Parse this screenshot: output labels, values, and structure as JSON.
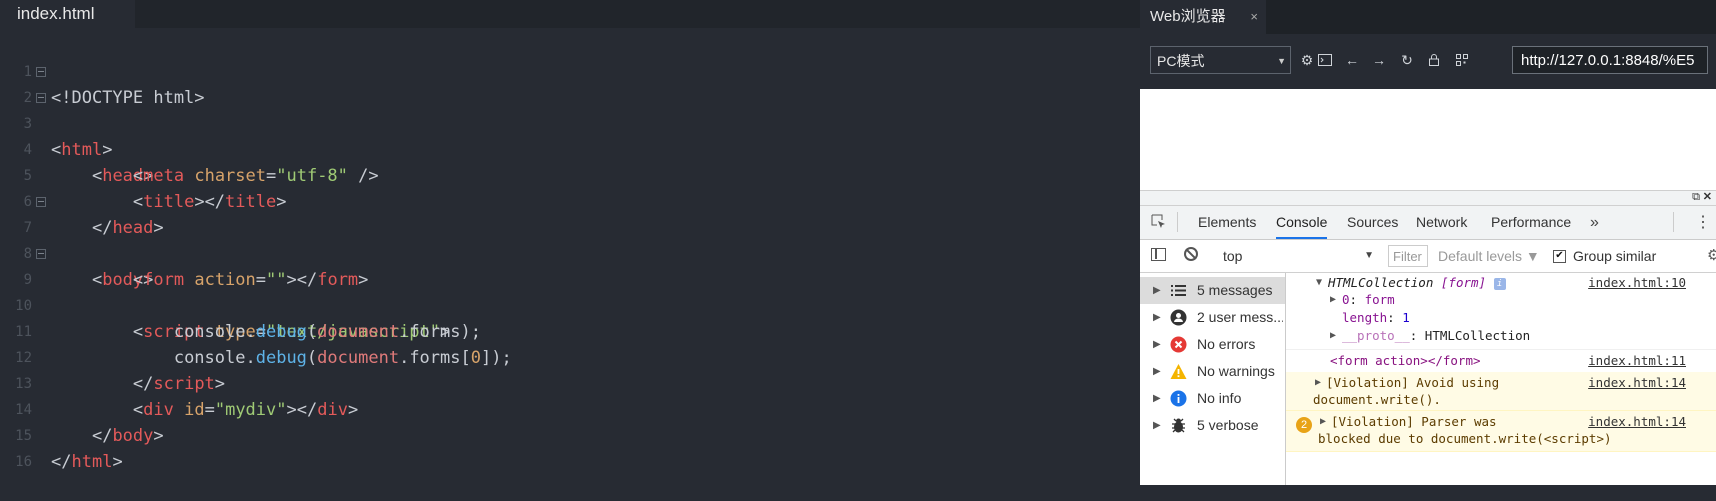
{
  "editor": {
    "tab_title": "index.html",
    "lines": [
      {
        "n": "1"
      },
      {
        "n": "2"
      },
      {
        "n": "3"
      },
      {
        "n": "4"
      },
      {
        "n": "5"
      },
      {
        "n": "6"
      },
      {
        "n": "7"
      },
      {
        "n": "8"
      },
      {
        "n": "9"
      },
      {
        "n": "10"
      },
      {
        "n": "11"
      },
      {
        "n": "12"
      },
      {
        "n": "13"
      },
      {
        "n": "14"
      },
      {
        "n": "15"
      },
      {
        "n": "16"
      }
    ],
    "code": {
      "l1": "<!DOCTYPE html>",
      "l2_open": "<",
      "l2_tag": "html",
      "l2_close": ">",
      "l3_tag": "head",
      "l4_tag": "meta",
      "l4_attr": "charset",
      "l4_val": "\"utf-8\"",
      "l4_end": " />",
      "l5_tag": "title",
      "l5_tag_end": "title",
      "l6_tag": "head",
      "l7_tag": "body",
      "l8_tag": "form",
      "l8_attr": "action",
      "l8_val": "\"\"",
      "l8_tag_end": "form",
      "l9_tag": "script",
      "l9_attr": "type",
      "l9_val": "\"text/javascript\"",
      "l10_obj": "console",
      "l10_fn": "debug",
      "l10_var": "document",
      "l10_prop": "forms",
      "l10_end": ");",
      "l11_obj": "console",
      "l11_fn": "debug",
      "l11_var": "document",
      "l11_prop": "forms",
      "l11_idx": "0",
      "l11_end": "]);",
      "l12_tag": "script",
      "l13_tag": "div",
      "l13_attr": "id",
      "l13_val": "\"mydiv\"",
      "l13_tag_end": "div",
      "l14_tag": "body",
      "l15_tag": "html"
    }
  },
  "browser": {
    "tab_title": "Web浏览器",
    "tab_close": "×",
    "mode_select": "PC模式",
    "url": "http://127.0.0.1:8848/%E5"
  },
  "devtools": {
    "tabs": [
      "Elements",
      "Console",
      "Sources",
      "Network",
      "Performance"
    ],
    "more": "»",
    "menu": "⋮",
    "context": "top",
    "filter_placeholder": "Filter",
    "levels": "Default levels ▼",
    "group_similar": "Group similar",
    "sidebar": [
      {
        "label": "5 messages",
        "icon": "list-icon"
      },
      {
        "label": "2 user mess...",
        "icon": "user-icon"
      },
      {
        "label": "No errors",
        "icon": "error-icon"
      },
      {
        "label": "No warnings",
        "icon": "warning-icon"
      },
      {
        "label": "No info",
        "icon": "info-icon"
      },
      {
        "label": "5 verbose",
        "icon": "bug-icon"
      }
    ],
    "log": {
      "r1_head": "HTMLCollection",
      "r1_form": "[form]",
      "r1_src": "index.html:10",
      "r1_c0_key": "0",
      "r1_c0_val": "form",
      "r1_c1_key": "length",
      "r1_c1_val": "1",
      "r1_c2_key": "__proto__",
      "r1_c2_val": "HTMLCollection",
      "r2_text": "<form action></form>",
      "r2_src": "index.html:11",
      "r3_text1": "[Violation] Avoid using",
      "r3_text2": "document.write().",
      "r3_src": "index.html:14",
      "r4_count": "2",
      "r4_text1": "[Violation] Parser was",
      "r4_text2": "blocked due to document.write(<script>)",
      "r4_src": "index.html:14"
    },
    "colors": {
      "active_tab": "#1a73e8",
      "error": "#e53935",
      "warning": "#f4b400",
      "info": "#1a73e8",
      "warn_bg": "#fffbe5"
    }
  }
}
